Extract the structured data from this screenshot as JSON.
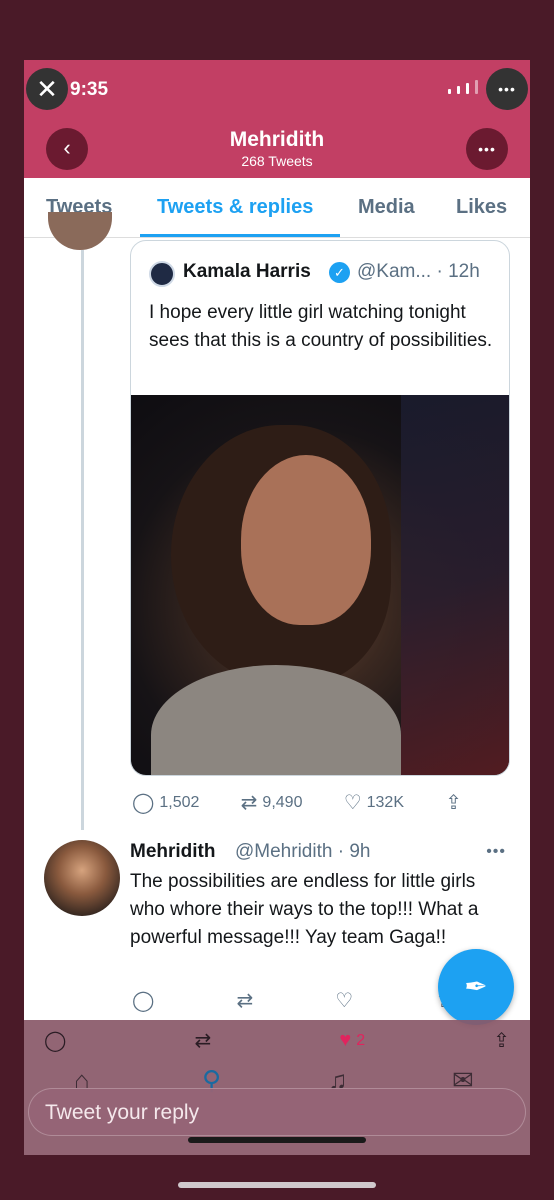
{
  "status": {
    "time": "9:35"
  },
  "header": {
    "name": "Mehridith",
    "tweet_count": "268 Tweets"
  },
  "tabs": [
    {
      "label": "Tweets"
    },
    {
      "label": "Tweets & replies"
    },
    {
      "label": "Media"
    },
    {
      "label": "Likes"
    }
  ],
  "quoted_tweet": {
    "name": "Kamala Harris",
    "handle": "@Kam... · 12h",
    "text": "I hope every little girl watching tonight sees that this is a country of possibilities.",
    "replies": "1,502",
    "retweets": "9,490",
    "likes": "132K"
  },
  "reply_tweet": {
    "name": "Mehridith",
    "handle": "@Mehridith · 9h",
    "text": "The possibilities are endless for little girls who whore their ways to the top!!!  What a powerful message!!! Yay team Gaga!!"
  },
  "bottom_bar": {
    "like_count": "2",
    "reply_placeholder": "Tweet your reply"
  },
  "colors": {
    "accent": "#1da1f2",
    "header": "#c23f64"
  }
}
